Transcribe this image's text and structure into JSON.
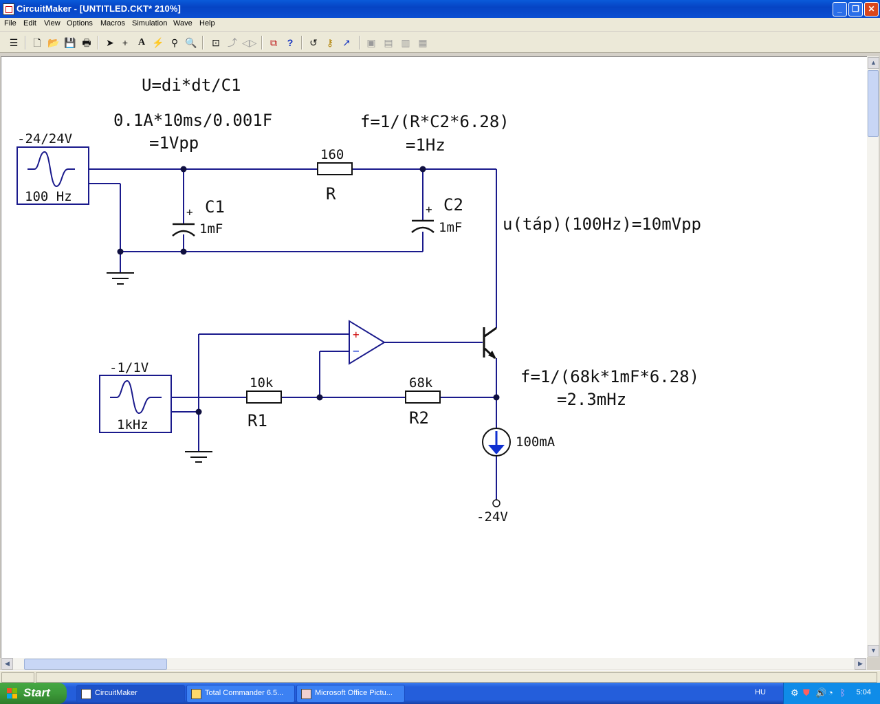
{
  "window": {
    "title": "CircuitMaker - [UNTITLED.CKT* 210%]"
  },
  "menu": [
    "File",
    "Edit",
    "View",
    "Options",
    "Macros",
    "Simulation",
    "Wave",
    "Help"
  ],
  "toolbar": {
    "icons": [
      "grid-icon",
      "new-file-icon",
      "open-folder-icon",
      "save-icon",
      "print-icon",
      "arrow-tool-icon",
      "wire-tool-icon",
      "text-tool-icon",
      "probe-tool-icon",
      "wand-tool-icon",
      "zoom-tool-icon",
      "fit-icon",
      "rotate-icon",
      "mirror-icon",
      "digital-icon",
      "help-icon",
      "undo-icon",
      "key-icon",
      "run-icon",
      "disabled-1-icon",
      "disabled-2-icon",
      "disabled-3-icon",
      "disabled-4-icon"
    ]
  },
  "schematic": {
    "formula_u": "U=di*dt/C1",
    "formula_u_calc": "0.1A*10ms/0.001F",
    "formula_u_result": "=1Vpp",
    "formula_f1": "f=1/(R*C2*6.28)",
    "formula_f1_result": "=1Hz",
    "ripple_note": "u(táp)(100Hz)=10mVpp",
    "formula_f2": "f=1/(68k*1mF*6.28)",
    "formula_f2_result": "=2.3mHz",
    "source1_label": "-24/24V",
    "source1_freq": "100 Hz",
    "source2_label": "-1/1V",
    "source2_freq": "1kHz",
    "r_value": "160",
    "r_name": "R",
    "c1_name": "C1",
    "c1_value": "1mF",
    "c2_name": "C2",
    "c2_value": "1mF",
    "r1_value": "10k",
    "r1_name": "R1",
    "r2_value": "68k",
    "r2_name": "R2",
    "current_source_value": "100mA",
    "supply_label": "-24V",
    "plus_sign": "+",
    "minus_sign": "−"
  },
  "taskbar": {
    "start": "Start",
    "tasks": [
      "CircuitMaker",
      "Total Commander 6.5...",
      "Microsoft Office Pictu..."
    ],
    "language": "HU",
    "clock": "5:04"
  },
  "colors": {
    "wire": "#1a1a8c",
    "node": "#101040",
    "titlebar": "#0a5ad9"
  }
}
